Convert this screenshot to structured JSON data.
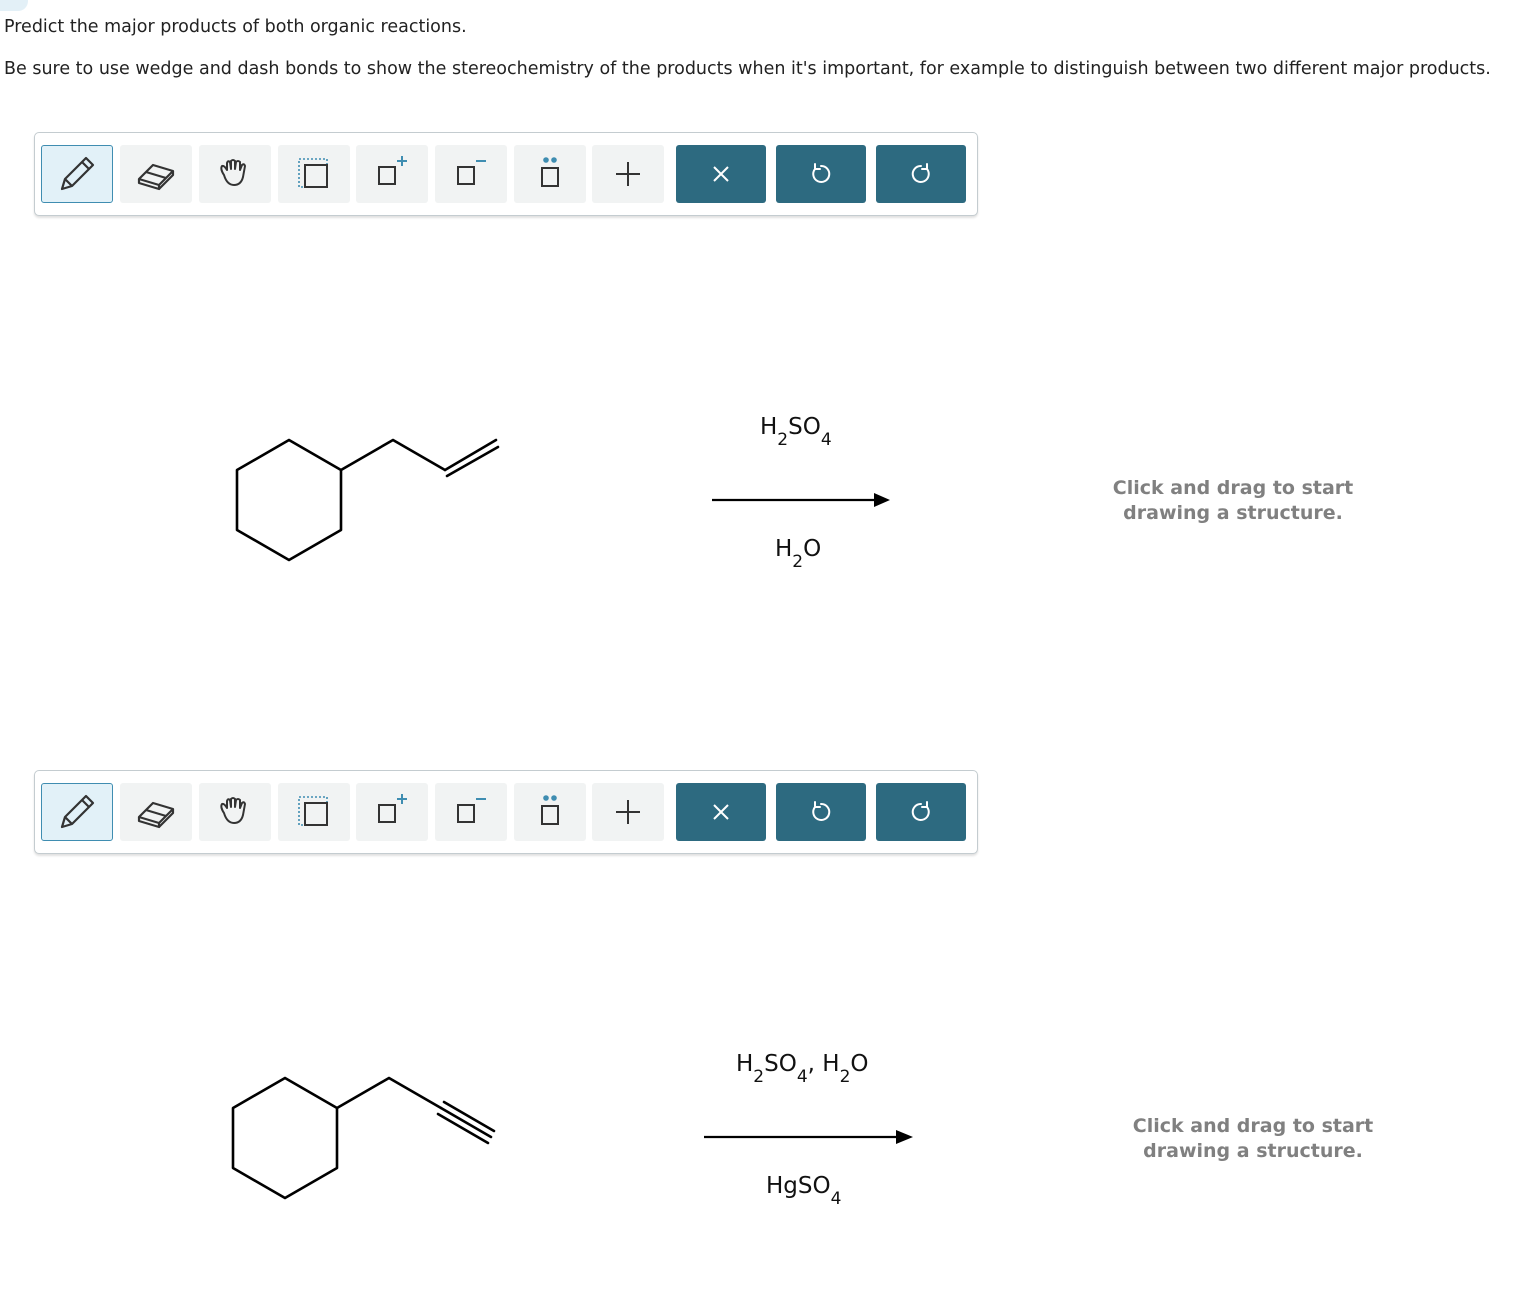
{
  "question": {
    "line1": "Predict the major products of both organic reactions.",
    "line2": "Be sure to use wedge and dash bonds to show the stereochemistry of the products when it's important, for example to distinguish between two different major products."
  },
  "toolbar": {
    "tools": [
      {
        "name": "pencil",
        "icon": "pencil-icon"
      },
      {
        "name": "eraser",
        "icon": "eraser-icon"
      },
      {
        "name": "hand",
        "icon": "hand-icon"
      },
      {
        "name": "select",
        "icon": "selection-box-icon"
      },
      {
        "name": "positive-charge",
        "icon": "positive-charge-icon"
      },
      {
        "name": "negative-charge",
        "icon": "negative-charge-icon"
      },
      {
        "name": "lone-pair",
        "icon": "lone-pair-icon"
      },
      {
        "name": "add",
        "icon": "plus-icon"
      }
    ],
    "actions": [
      {
        "name": "clear",
        "icon": "close-icon"
      },
      {
        "name": "undo",
        "icon": "undo-icon"
      },
      {
        "name": "redo",
        "icon": "redo-icon"
      }
    ],
    "accent": "#2d6a80",
    "active_bg": "#e2f1f8"
  },
  "reaction1": {
    "above": {
      "h": "H",
      "h_sub": "2",
      "so": "SO",
      "so_sub": "4"
    },
    "below": {
      "h": "H",
      "h_sub": "2",
      "o": "O"
    },
    "hint_line1": "Click and drag to start",
    "hint_line2": "drawing a structure."
  },
  "reaction2": {
    "above": {
      "h": "H",
      "h_sub": "2",
      "so": "SO",
      "so_sub": "4",
      "sep": ",",
      "h2": "H",
      "h2_sub": "2",
      "o": "O"
    },
    "below": {
      "hg": "HgSO",
      "hg_sub": "4"
    },
    "hint_line1": "Click and drag to start",
    "hint_line2": "drawing a structure."
  }
}
